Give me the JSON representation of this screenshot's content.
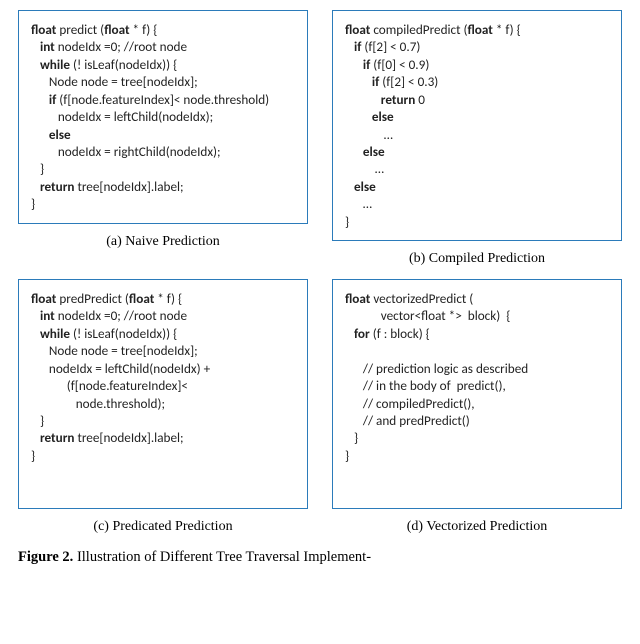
{
  "panels": {
    "a": {
      "caption": "(a) Naive Prediction",
      "code": {
        "l1a": "float",
        "l1b": " predict (",
        "l1c": "float",
        "l1d": " * f) {",
        "l2a": "   ",
        "l2b": "int",
        "l2c": " nodeIdx =0; //root node",
        "l3a": "   ",
        "l3b": "while",
        "l3c": " (! isLeaf(nodeIdx)) {",
        "l4": "      Node node = tree[nodeIdx];",
        "l5a": "      ",
        "l5b": "if",
        "l5c": " (f[node.featureIndex]< node.threshold)",
        "l6": "         nodeIdx = leftChild(nodeIdx);",
        "l7a": "      ",
        "l7b": "else",
        "l8": "         nodeIdx = rightChild(nodeIdx);",
        "l9": "   }",
        "l10a": "   ",
        "l10b": "return",
        "l10c": " tree[nodeIdx].label;",
        "l11": "}"
      }
    },
    "b": {
      "caption": "(b) Compiled Prediction",
      "code": {
        "l1a": "float",
        "l1b": " compiledPredict (",
        "l1c": "float",
        "l1d": " * f) {",
        "l2a": "   ",
        "l2b": "if",
        "l2c": " (f[2] < 0.7)",
        "l3a": "      ",
        "l3b": "if",
        "l3c": " (f[0] < 0.9)",
        "l4a": "         ",
        "l4b": "if",
        "l4c": " (f[2] < 0.3)",
        "l5a": "            ",
        "l5b": "return",
        "l5c": " 0",
        "l6a": "         ",
        "l6b": "else",
        "l7": "             …",
        "l8a": "      ",
        "l8b": "else",
        "l9": "          …",
        "l10a": "   ",
        "l10b": "else",
        "l11": "      …",
        "l12": "}"
      }
    },
    "c": {
      "caption": "(c) Predicated Prediction",
      "code": {
        "l1a": "float",
        "l1b": " predPredict (",
        "l1c": "float",
        "l1d": " * f) {",
        "l2a": "   ",
        "l2b": "int",
        "l2c": " nodeIdx =0; //root node",
        "l3a": "   ",
        "l3b": "while",
        "l3c": " (! isLeaf(nodeIdx)) {",
        "l4": "      Node node = tree[nodeIdx];",
        "l5": "      nodeIdx = leftChild(nodeIdx) +",
        "l6": "            (f[node.featureIndex]<",
        "l7": "               node.threshold);",
        "l8": "   }",
        "l9a": "   ",
        "l9b": "return",
        "l9c": " tree[nodeIdx].label;",
        "l10": "}"
      }
    },
    "d": {
      "caption": "(d) Vectorized Prediction",
      "code": {
        "l1a": "float",
        "l1b": " vectorizedPredict (",
        "l2": "            vector<float *>  block)  {",
        "l3a": "   ",
        "l3b": "for",
        "l3c": " (f : block) {",
        "blank1": " ",
        "l4": "      // prediction logic as described",
        "l5": "      // in the body of  predict(),",
        "l6": "      // compiledPredict(),",
        "l7": "      // and predPredict()",
        "l8": "   }",
        "l9": "}"
      }
    }
  },
  "figure": {
    "label": "Figure 2.",
    "text": "  Illustration of Different Tree Traversal Implement-"
  }
}
